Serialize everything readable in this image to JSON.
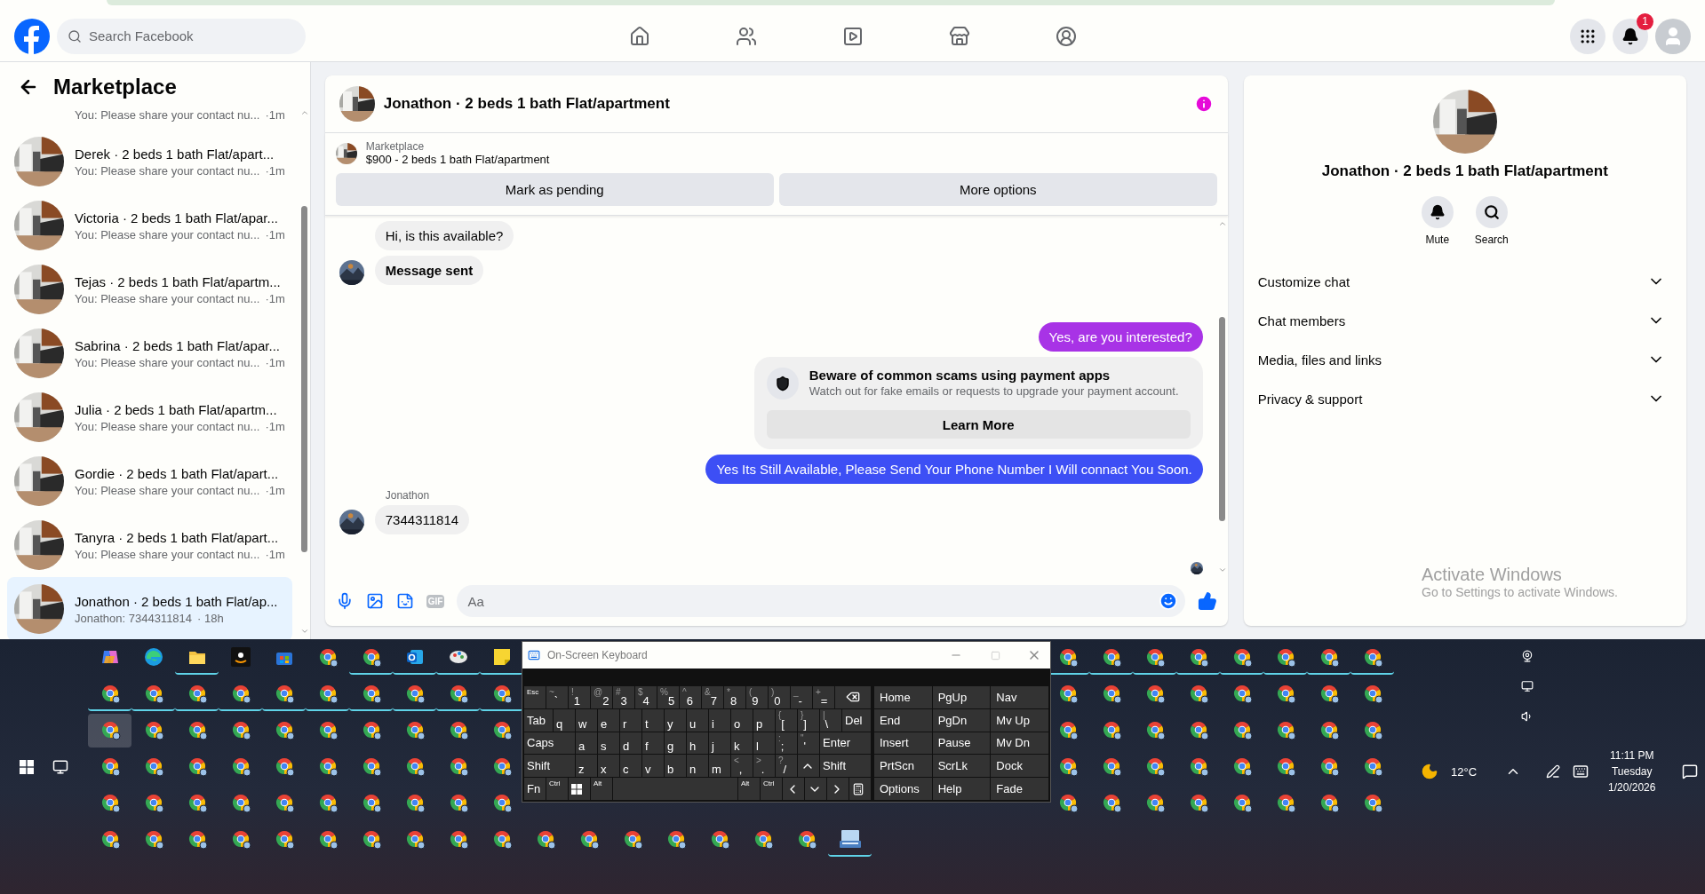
{
  "header": {
    "search": {
      "placeholder": "Search Facebook"
    },
    "notifications": {
      "badge": "1"
    }
  },
  "sidebar": {
    "title": "Marketplace",
    "conversations": [
      {
        "kind": "partial",
        "preview": "You: Please share your contact nu...",
        "time": "·1m",
        "selected": false
      },
      {
        "kind": "full",
        "title": "Derek · 2 beds 1 bath Flat/apart...",
        "preview": "You: Please share your contact nu...",
        "time": "·1m",
        "selected": false
      },
      {
        "kind": "full",
        "title": "Victoria · 2 beds 1 bath Flat/apar...",
        "preview": "You: Please share your contact nu...",
        "time": "·1m",
        "selected": false
      },
      {
        "kind": "full",
        "title": "Tejas · 2 beds 1 bath Flat/apartm...",
        "preview": "You: Please share your contact nu...",
        "time": "·1m",
        "selected": false
      },
      {
        "kind": "full",
        "title": "Sabrina · 2 beds 1 bath Flat/apar...",
        "preview": "You: Please share your contact nu...",
        "time": "·1m",
        "selected": false
      },
      {
        "kind": "full",
        "title": "Julia · 2 beds 1 bath Flat/apartm...",
        "preview": "You: Please share your contact nu...",
        "time": "·1m",
        "selected": false
      },
      {
        "kind": "full",
        "title": "Gordie · 2 beds 1 bath Flat/apart...",
        "preview": "You: Please share your contact nu...",
        "time": "·1m",
        "selected": false
      },
      {
        "kind": "full",
        "title": "Tanyra · 2 beds 1 bath Flat/apart...",
        "preview": "You: Please share your contact nu...",
        "time": "·1m",
        "selected": false
      },
      {
        "kind": "full",
        "title": "Jonathon · 2 beds 1 bath Flat/ap...",
        "preview": "Jonathon: 7344311814",
        "time": "· 18h",
        "selected": true
      }
    ]
  },
  "chat": {
    "title": "Jonathon · 2 beds 1 bath Flat/apartment",
    "listing": {
      "label": "Marketplace",
      "text": "$900 - 2 beds 1 bath Flat/apartment"
    },
    "actions": [
      "Mark as pending",
      "More options"
    ],
    "messages": [
      {
        "kind": "incoming",
        "text": "Hi, is this available?",
        "avatar": false
      },
      {
        "kind": "status",
        "text": "Message sent",
        "avatar": true
      },
      {
        "kind": "outgoing",
        "text": "Yes, are you interested?",
        "color": "#a833e6"
      },
      {
        "kind": "notice",
        "title": "Beware of common scams using payment apps",
        "text": "Watch out for fake emails or requests to upgrade your payment account.",
        "button": "Learn More"
      },
      {
        "kind": "outgoing",
        "text": "Yes Its Still Available, Please Send Your Phone Number I Will connact You Soon.",
        "color": "#3d4ff5"
      },
      {
        "kind": "incoming",
        "sender": "Jonathon",
        "text": "7344311814",
        "avatar": true
      }
    ],
    "composer": {
      "placeholder": "Aa",
      "gif": "GIF"
    }
  },
  "details": {
    "title": "Jonathon · 2 beds 1 bath Flat/apartment",
    "actions": [
      {
        "kind": "mute",
        "label": "Mute"
      },
      {
        "kind": "search",
        "label": "Search"
      }
    ],
    "sections": [
      "Customize chat",
      "Chat members",
      "Media, files and links",
      "Privacy & support"
    ]
  },
  "activation": {
    "title": "Activate Windows",
    "text": "Go to Settings to activate Windows."
  },
  "keyboard": {
    "title": "On-Screen Keyboard",
    "rows": [
      [
        {
          "kind": "small",
          "label": "Esc"
        },
        {
          "kind": "char",
          "shift": "~",
          "label": "`"
        },
        {
          "kind": "char",
          "shift": "!",
          "label": "1"
        },
        {
          "kind": "char",
          "shift": "@",
          "label": "2"
        },
        {
          "kind": "char",
          "shift": "#",
          "label": "3"
        },
        {
          "kind": "char",
          "shift": "$",
          "label": "4"
        },
        {
          "kind": "char",
          "shift": "%",
          "label": "5"
        },
        {
          "kind": "char",
          "shift": "^",
          "label": "6"
        },
        {
          "kind": "char",
          "shift": "&",
          "label": "7"
        },
        {
          "kind": "char",
          "shift": "*",
          "label": "8"
        },
        {
          "kind": "char",
          "shift": "(",
          "label": "9"
        },
        {
          "kind": "char",
          "shift": ")",
          "label": "0"
        },
        {
          "kind": "char",
          "shift": "_",
          "label": "-"
        },
        {
          "kind": "char",
          "shift": "+",
          "label": "="
        },
        {
          "kind": "backspace"
        }
      ],
      [
        {
          "kind": "mod",
          "label": "Tab"
        },
        {
          "kind": "char",
          "label": "q"
        },
        {
          "kind": "char",
          "label": "w"
        },
        {
          "kind": "char",
          "label": "e"
        },
        {
          "kind": "char",
          "label": "r"
        },
        {
          "kind": "char",
          "label": "t"
        },
        {
          "kind": "char",
          "label": "y"
        },
        {
          "kind": "char",
          "label": "u"
        },
        {
          "kind": "char",
          "label": "i"
        },
        {
          "kind": "char",
          "label": "o"
        },
        {
          "kind": "char",
          "label": "p"
        },
        {
          "kind": "char",
          "shift": "{",
          "label": "["
        },
        {
          "kind": "char",
          "shift": "}",
          "label": "]"
        },
        {
          "kind": "char",
          "shift": "|",
          "label": "\\"
        },
        {
          "kind": "mod",
          "label": "Del"
        }
      ],
      [
        {
          "kind": "mod",
          "label": "Caps"
        },
        {
          "kind": "char",
          "label": "a"
        },
        {
          "kind": "char",
          "label": "s"
        },
        {
          "kind": "char",
          "label": "d"
        },
        {
          "kind": "char",
          "label": "f"
        },
        {
          "kind": "char",
          "label": "g"
        },
        {
          "kind": "char",
          "label": "h"
        },
        {
          "kind": "char",
          "label": "j"
        },
        {
          "kind": "char",
          "label": "k"
        },
        {
          "kind": "char",
          "label": "l"
        },
        {
          "kind": "char",
          "shift": ":",
          "label": ";"
        },
        {
          "kind": "char",
          "shift": "\"",
          "label": "'"
        },
        {
          "kind": "mod",
          "label": "Enter"
        }
      ],
      [
        {
          "kind": "mod",
          "label": "Shift"
        },
        {
          "kind": "char",
          "label": "z"
        },
        {
          "kind": "char",
          "label": "x"
        },
        {
          "kind": "char",
          "label": "c"
        },
        {
          "kind": "char",
          "label": "v"
        },
        {
          "kind": "char",
          "label": "b"
        },
        {
          "kind": "char",
          "label": "n"
        },
        {
          "kind": "char",
          "label": "m"
        },
        {
          "kind": "char",
          "shift": "<",
          "label": ","
        },
        {
          "kind": "char",
          "shift": ">",
          "label": "."
        },
        {
          "kind": "char",
          "shift": "?",
          "label": "/"
        },
        {
          "kind": "up"
        },
        {
          "kind": "mod",
          "label": "Shift"
        }
      ],
      [
        {
          "kind": "fn",
          "label": "Fn"
        },
        {
          "kind": "small",
          "label": "Ctrl"
        },
        {
          "kind": "windows"
        },
        {
          "kind": "small",
          "label": "Alt"
        },
        {
          "kind": "space"
        },
        {
          "kind": "small",
          "label": "Alt"
        },
        {
          "kind": "small",
          "label": "Ctrl"
        },
        {
          "kind": "left"
        },
        {
          "kind": "down"
        },
        {
          "kind": "right"
        },
        {
          "kind": "menu"
        }
      ]
    ],
    "nav": [
      [
        "Home",
        "PgUp",
        "Nav"
      ],
      [
        "End",
        "PgDn",
        "Mv Up"
      ],
      [
        "Insert",
        "Pause",
        "Mv Dn"
      ],
      [
        "PrtScn",
        "ScrLk",
        "Dock"
      ],
      [
        "Options",
        "Help",
        "Fade"
      ]
    ]
  },
  "taskbar": {
    "rows": [
      [
        {
          "kind": "copilot",
          "running": false,
          "selected": false
        },
        {
          "kind": "edge",
          "running": false,
          "selected": false
        },
        {
          "kind": "folder",
          "running": true,
          "selected": false
        },
        {
          "kind": "amazon",
          "running": false,
          "selected": false
        },
        {
          "kind": "store",
          "running": false,
          "selected": false
        },
        {
          "kind": "chrome",
          "running": false,
          "selected": false
        },
        {
          "kind": "chrome",
          "running": true,
          "selected": false
        },
        {
          "kind": "mail",
          "running": true,
          "selected": false
        },
        {
          "kind": "palette",
          "running": true,
          "selected": false
        },
        {
          "kind": "note",
          "running": true,
          "selected": false
        },
        {
          "kind": "gap"
        },
        {
          "kind": "gap"
        },
        {
          "kind": "gap"
        },
        {
          "kind": "gap"
        },
        {
          "kind": "gap"
        },
        {
          "kind": "gap"
        },
        {
          "kind": "gap"
        },
        {
          "kind": "gap"
        },
        {
          "kind": "gap"
        },
        {
          "kind": "gap"
        },
        {
          "kind": "gap"
        },
        {
          "kind": "gap"
        },
        {
          "kind": "chrome",
          "running": true,
          "selected": false
        },
        {
          "kind": "chrome",
          "running": true,
          "selected": false
        },
        {
          "kind": "chrome",
          "running": true,
          "selected": false
        },
        {
          "kind": "chrome",
          "running": true,
          "selected": false
        },
        {
          "kind": "chrome",
          "running": true,
          "selected": false
        },
        {
          "kind": "chrome",
          "running": true,
          "selected": false
        },
        {
          "kind": "chrome",
          "running": true,
          "selected": false
        },
        {
          "kind": "chrome",
          "running": true,
          "selected": false
        }
      ],
      [
        {
          "kind": "chrome",
          "running": true,
          "selected": false
        },
        {
          "kind": "chrome",
          "running": true,
          "selected": false
        },
        {
          "kind": "chrome",
          "running": true,
          "selected": false
        },
        {
          "kind": "chrome",
          "running": true,
          "selected": false
        },
        {
          "kind": "chrome",
          "running": true,
          "selected": false
        },
        {
          "kind": "chrome",
          "running": true,
          "selected": false
        },
        {
          "kind": "chrome",
          "running": true,
          "selected": false
        },
        {
          "kind": "chrome",
          "running": true,
          "selected": false
        },
        {
          "kind": "chrome",
          "running": true,
          "selected": false
        },
        {
          "kind": "chrome",
          "running": true,
          "selected": false
        },
        {
          "kind": "gap"
        },
        {
          "kind": "gap"
        },
        {
          "kind": "gap"
        },
        {
          "kind": "gap"
        },
        {
          "kind": "gap"
        },
        {
          "kind": "gap"
        },
        {
          "kind": "gap"
        },
        {
          "kind": "gap"
        },
        {
          "kind": "gap"
        },
        {
          "kind": "gap"
        },
        {
          "kind": "gap"
        },
        {
          "kind": "gap"
        },
        {
          "kind": "chrome",
          "running": false,
          "selected": false
        },
        {
          "kind": "chrome",
          "running": false,
          "selected": false
        },
        {
          "kind": "chrome",
          "running": false,
          "selected": false
        },
        {
          "kind": "chrome",
          "running": false,
          "selected": false
        },
        {
          "kind": "chrome",
          "running": false,
          "selected": false
        },
        {
          "kind": "chrome",
          "running": false,
          "selected": false
        },
        {
          "kind": "chrome",
          "running": false,
          "selected": false
        },
        {
          "kind": "chrome",
          "running": false,
          "selected": false
        }
      ],
      [
        {
          "kind": "chrome",
          "running": false,
          "selected": true
        },
        {
          "kind": "chrome",
          "running": false,
          "selected": false
        },
        {
          "kind": "chrome",
          "running": false,
          "selected": false
        },
        {
          "kind": "chrome",
          "running": false,
          "selected": false
        },
        {
          "kind": "chrome",
          "running": false,
          "selected": false
        },
        {
          "kind": "chrome",
          "running": false,
          "selected": false
        },
        {
          "kind": "chrome",
          "running": false,
          "selected": false
        },
        {
          "kind": "chrome",
          "running": false,
          "selected": false
        },
        {
          "kind": "chrome",
          "running": false,
          "selected": false
        },
        {
          "kind": "chrome",
          "running": false,
          "selected": false
        },
        {
          "kind": "gap"
        },
        {
          "kind": "gap"
        },
        {
          "kind": "gap"
        },
        {
          "kind": "gap"
        },
        {
          "kind": "gap"
        },
        {
          "kind": "gap"
        },
        {
          "kind": "gap"
        },
        {
          "kind": "gap"
        },
        {
          "kind": "gap"
        },
        {
          "kind": "gap"
        },
        {
          "kind": "gap"
        },
        {
          "kind": "gap"
        },
        {
          "kind": "chrome",
          "running": false,
          "selected": false
        },
        {
          "kind": "chrome",
          "running": false,
          "selected": false
        },
        {
          "kind": "chrome",
          "running": false,
          "selected": false
        },
        {
          "kind": "chrome",
          "running": false,
          "selected": false
        },
        {
          "kind": "chrome",
          "running": false,
          "selected": false
        },
        {
          "kind": "chrome",
          "running": false,
          "selected": false
        },
        {
          "kind": "chrome",
          "running": false,
          "selected": false
        },
        {
          "kind": "chrome",
          "running": false,
          "selected": false
        }
      ],
      [
        {
          "kind": "chrome",
          "running": false,
          "selected": false
        },
        {
          "kind": "chrome",
          "running": false,
          "selected": false
        },
        {
          "kind": "chrome",
          "running": false,
          "selected": false
        },
        {
          "kind": "chrome",
          "running": false,
          "selected": false
        },
        {
          "kind": "chrome",
          "running": false,
          "selected": false
        },
        {
          "kind": "chrome",
          "running": false,
          "selected": false
        },
        {
          "kind": "chrome",
          "running": false,
          "selected": false
        },
        {
          "kind": "chrome",
          "running": false,
          "selected": false
        },
        {
          "kind": "chrome",
          "running": false,
          "selected": false
        },
        {
          "kind": "chrome",
          "running": false,
          "selected": false
        },
        {
          "kind": "gap"
        },
        {
          "kind": "gap"
        },
        {
          "kind": "gap"
        },
        {
          "kind": "gap"
        },
        {
          "kind": "gap"
        },
        {
          "kind": "gap"
        },
        {
          "kind": "gap"
        },
        {
          "kind": "gap"
        },
        {
          "kind": "gap"
        },
        {
          "kind": "gap"
        },
        {
          "kind": "gap"
        },
        {
          "kind": "gap"
        },
        {
          "kind": "chrome",
          "running": false,
          "selected": false
        },
        {
          "kind": "chrome",
          "running": false,
          "selected": false
        },
        {
          "kind": "chrome",
          "running": false,
          "selected": false
        },
        {
          "kind": "chrome",
          "running": false,
          "selected": false
        },
        {
          "kind": "chrome",
          "running": false,
          "selected": false
        },
        {
          "kind": "chrome",
          "running": false,
          "selected": false
        },
        {
          "kind": "chrome",
          "running": false,
          "selected": false
        },
        {
          "kind": "chrome",
          "running": false,
          "selected": false
        }
      ],
      [
        {
          "kind": "chrome",
          "running": false,
          "selected": false
        },
        {
          "kind": "chrome",
          "running": false,
          "selected": false
        },
        {
          "kind": "chrome",
          "running": false,
          "selected": false
        },
        {
          "kind": "chrome",
          "running": false,
          "selected": false
        },
        {
          "kind": "chrome",
          "running": false,
          "selected": false
        },
        {
          "kind": "chrome",
          "running": false,
          "selected": false
        },
        {
          "kind": "chrome",
          "running": false,
          "selected": false
        },
        {
          "kind": "chrome",
          "running": false,
          "selected": false
        },
        {
          "kind": "chrome",
          "running": false,
          "selected": false
        },
        {
          "kind": "chrome",
          "running": false,
          "selected": false
        },
        {
          "kind": "gap"
        },
        {
          "kind": "gap"
        },
        {
          "kind": "gap"
        },
        {
          "kind": "gap"
        },
        {
          "kind": "gap"
        },
        {
          "kind": "gap"
        },
        {
          "kind": "gap"
        },
        {
          "kind": "gap"
        },
        {
          "kind": "gap"
        },
        {
          "kind": "gap"
        },
        {
          "kind": "gap"
        },
        {
          "kind": "gap"
        },
        {
          "kind": "chrome",
          "running": false,
          "selected": false
        },
        {
          "kind": "chrome",
          "running": false,
          "selected": false
        },
        {
          "kind": "chrome",
          "running": false,
          "selected": false
        },
        {
          "kind": "chrome",
          "running": false,
          "selected": false
        },
        {
          "kind": "chrome",
          "running": false,
          "selected": false
        },
        {
          "kind": "chrome",
          "running": false,
          "selected": false
        },
        {
          "kind": "chrome",
          "running": false,
          "selected": false
        },
        {
          "kind": "chrome",
          "running": false,
          "selected": false
        }
      ],
      [
        {
          "kind": "chrome",
          "running": false,
          "selected": false
        },
        {
          "kind": "chrome",
          "running": false,
          "selected": false
        },
        {
          "kind": "chrome",
          "running": false,
          "selected": false
        },
        {
          "kind": "chrome",
          "running": false,
          "selected": false
        },
        {
          "kind": "chrome",
          "running": false,
          "selected": false
        },
        {
          "kind": "chrome",
          "running": false,
          "selected": false
        },
        {
          "kind": "chrome",
          "running": false,
          "selected": false
        },
        {
          "kind": "chrome",
          "running": false,
          "selected": false
        },
        {
          "kind": "chrome",
          "running": false,
          "selected": false
        },
        {
          "kind": "chrome",
          "running": false,
          "selected": false
        },
        {
          "kind": "chrome",
          "running": false,
          "selected": false
        },
        {
          "kind": "chrome",
          "running": false,
          "selected": false
        },
        {
          "kind": "chrome",
          "running": false,
          "selected": false
        },
        {
          "kind": "chrome",
          "running": false,
          "selected": false
        },
        {
          "kind": "chrome",
          "running": false,
          "selected": false
        },
        {
          "kind": "chrome",
          "running": false,
          "selected": false
        },
        {
          "kind": "chrome",
          "running": false,
          "selected": false
        },
        {
          "kind": "keyboard",
          "running": true,
          "selected": false
        }
      ]
    ]
  },
  "tray": {
    "temperature": "12°C",
    "time": "11:11 PM",
    "day": "Tuesday",
    "date": "1/20/2026"
  }
}
